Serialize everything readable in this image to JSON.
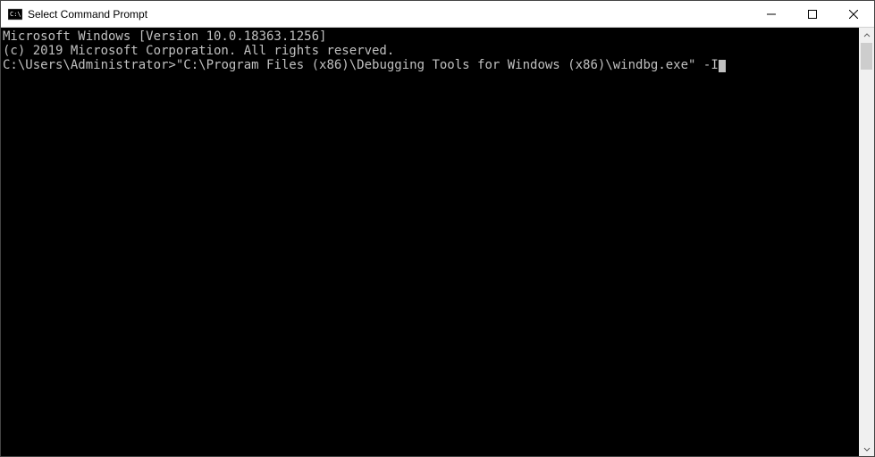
{
  "titlebar": {
    "title": "Select Command Prompt"
  },
  "console": {
    "line1": "Microsoft Windows [Version 10.0.18363.1256]",
    "line2": "(c) 2019 Microsoft Corporation. All rights reserved.",
    "blank": "",
    "prompt": "C:\\Users\\Administrator>",
    "command": "\"C:\\Program Files (x86)\\Debugging Tools for Windows (x86)\\windbg.exe\" -I"
  }
}
